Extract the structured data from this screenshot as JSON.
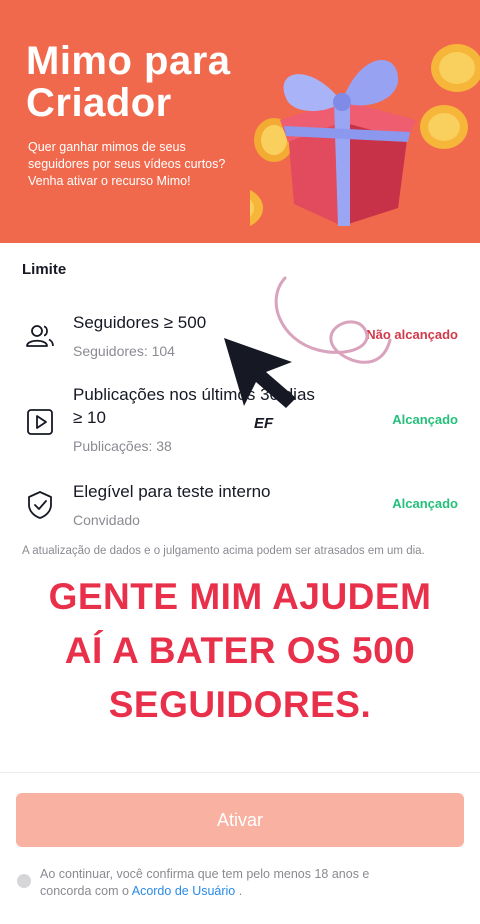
{
  "hero": {
    "title_line1": "Mimo para",
    "title_line2": "Criador",
    "desc_line1": "Quer ganhar mimos de seus",
    "desc_line2": "seguidores por seus vídeos curtos?",
    "desc_line3": "Venha ativar o recurso Mimo!"
  },
  "limit": {
    "title": "Limite",
    "rows": [
      {
        "icon": "followers-icon",
        "title": "Seguidores ≥ 500",
        "sub": "Seguidores: 104",
        "status": "Não alcançado"
      },
      {
        "icon": "video-play-icon",
        "title_line1": "Publicações nos últimos 30 dias",
        "title_line2": "≥ 10",
        "sub": "Publicações: 38",
        "status": "Alcançado"
      },
      {
        "icon": "shield-check-icon",
        "title": "Elegível para teste interno",
        "sub": "Convidado",
        "status": "Alcançado"
      }
    ]
  },
  "note": "A atualização de dados e o julgamento acima podem ser atrasados em um dia.",
  "overlay": {
    "line1": "GENTE MIM AJUDEM",
    "line2": "AÍ A BATER OS 500",
    "line3": "SEGUIDORES.",
    "watermark": "EF"
  },
  "footer": {
    "button": "Ativar",
    "consent_text": "Ao continuar, você confirma que tem pelo menos 18 anos e concorda com o",
    "consent_link": "Acordo de Usuário",
    "consent_end": " ."
  },
  "colors": {
    "hero_bg": "#f0694d",
    "not_reached": "#d23a4a",
    "reached": "#24c07a",
    "overlay_text": "#e8304b",
    "button_disabled": "#f9b1a2",
    "link": "#2a8be8"
  }
}
